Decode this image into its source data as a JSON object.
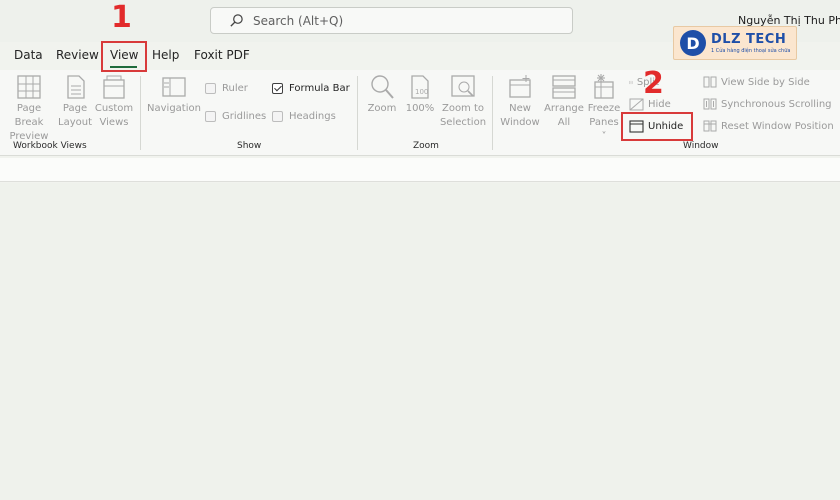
{
  "search": {
    "placeholder": "Search (Alt+Q)"
  },
  "user": {
    "name": "Nguyễn Thị Thu Phươ"
  },
  "logo": {
    "badge": "D",
    "text": "DLZ TECH",
    "sub": "1 Cửa hàng điện thoại sửa chữa"
  },
  "tabs": [
    "Data",
    "Review",
    "View",
    "Help",
    "Foxit PDF"
  ],
  "active_tab": "View",
  "groups": {
    "workbook_views": {
      "label": "Workbook Views",
      "buttons": [
        {
          "line1": "Page Break",
          "line2": "Preview",
          "icon": "page-break-preview-icon"
        },
        {
          "line1": "Page",
          "line2": "Layout",
          "icon": "page-layout-icon"
        },
        {
          "line1": "Custom",
          "line2": "Views",
          "icon": "custom-views-icon"
        }
      ]
    },
    "show": {
      "label": "Show",
      "navigation": "Navigation",
      "ruler": "Ruler",
      "gridlines": "Gridlines",
      "formula_bar": "Formula Bar",
      "headings": "Headings",
      "formula_bar_checked": true
    },
    "zoom": {
      "label": "Zoom",
      "buttons": [
        {
          "line1": "Zoom",
          "line2": "",
          "icon": "zoom-icon"
        },
        {
          "line1": "100%",
          "line2": "",
          "icon": "zoom-100-icon"
        },
        {
          "line1": "Zoom to",
          "line2": "Selection",
          "icon": "zoom-selection-icon"
        }
      ]
    },
    "window": {
      "label": "Window",
      "new_window": {
        "line1": "New",
        "line2": "Window"
      },
      "arrange_all": {
        "line1": "Arrange",
        "line2": "All"
      },
      "freeze_panes": {
        "line1": "Freeze",
        "line2": "Panes ˅"
      },
      "split": "Split",
      "hide": "Hide",
      "unhide": "Unhide",
      "view_side_by_side": "View Side by Side",
      "synchronous_scrolling": "Synchronous Scrolling",
      "reset_window_position": "Reset Window Position"
    }
  },
  "annotations": {
    "step1": "1",
    "step2": "2"
  },
  "colors": {
    "accent": "#1e6b3c",
    "annotation": "#e22b2b"
  }
}
